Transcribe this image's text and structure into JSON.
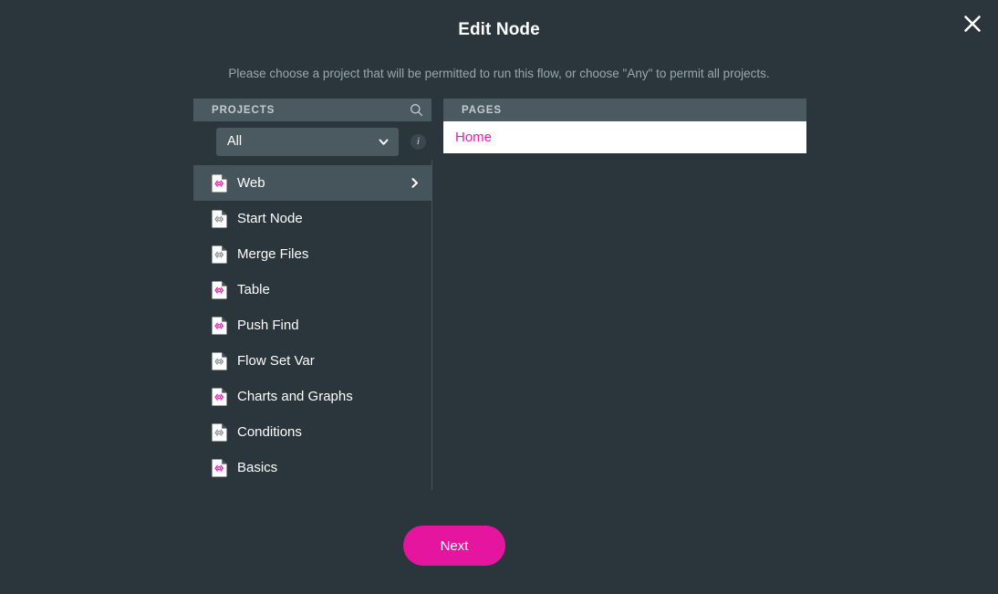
{
  "dialog": {
    "title": "Edit Node",
    "subtitle": "Please choose a project that will be permitted to run this flow, or choose \"Any\" to permit all projects.",
    "close_label": "×",
    "background_color": "#2a353c",
    "accent_color": "#e5159f"
  },
  "projects_panel": {
    "header": "PROJECTS",
    "search_icon": "search-icon",
    "filter": {
      "value": "All",
      "chevron_icon": "chevron-down-icon"
    },
    "info_icon": "info-icon",
    "info_label": "i",
    "items": [
      {
        "label": "Web",
        "icon": "file-code-icon",
        "icon_color": "#e81cae",
        "selected": true,
        "has_chevron": true
      },
      {
        "label": "Start Node",
        "icon": "file-code-icon",
        "icon_color": "#8b9096",
        "selected": false,
        "has_chevron": false
      },
      {
        "label": "Merge Files",
        "icon": "file-code-icon",
        "icon_color": "#8b9096",
        "selected": false,
        "has_chevron": false
      },
      {
        "label": "Table",
        "icon": "file-code-icon",
        "icon_color": "#e81cae",
        "selected": false,
        "has_chevron": false
      },
      {
        "label": "Push Find",
        "icon": "file-code-icon",
        "icon_color": "#e81cae",
        "selected": false,
        "has_chevron": false
      },
      {
        "label": "Flow Set Var",
        "icon": "file-code-icon",
        "icon_color": "#8b9096",
        "selected": false,
        "has_chevron": false
      },
      {
        "label": "Charts and Graphs",
        "icon": "file-code-icon",
        "icon_color": "#e81cae",
        "selected": false,
        "has_chevron": false
      },
      {
        "label": "Conditions",
        "icon": "file-code-icon",
        "icon_color": "#8b9096",
        "selected": false,
        "has_chevron": false
      },
      {
        "label": "Basics",
        "icon": "file-code-icon",
        "icon_color": "#e81cae",
        "selected": false,
        "has_chevron": false
      }
    ]
  },
  "pages_panel": {
    "header": "PAGES",
    "items": [
      {
        "label": "Home"
      }
    ]
  },
  "footer": {
    "next_label": "Next"
  }
}
